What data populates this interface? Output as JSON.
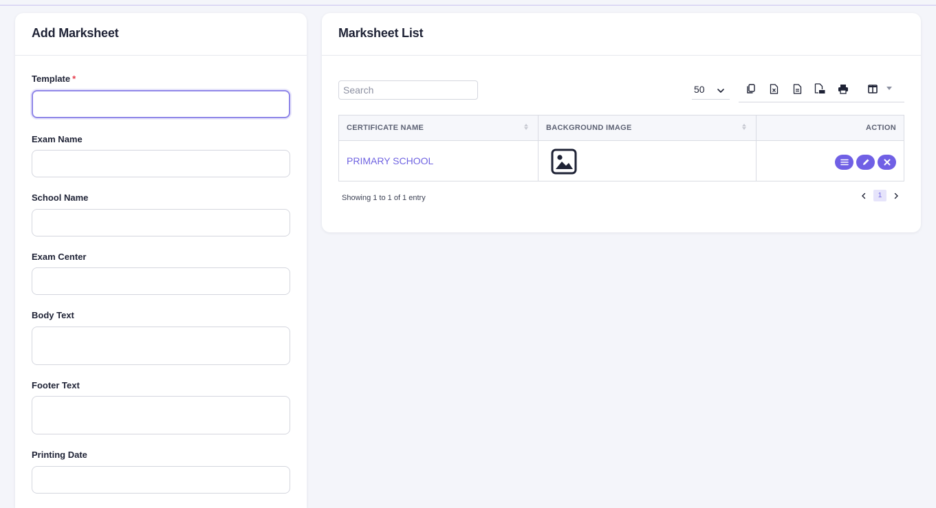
{
  "add_form": {
    "title": "Add Marksheet",
    "fields": [
      {
        "label": "Template",
        "required_mark": "*",
        "value": ""
      },
      {
        "label": "Exam Name",
        "value": ""
      },
      {
        "label": "School Name",
        "value": ""
      },
      {
        "label": "Exam Center",
        "value": ""
      },
      {
        "label": "Body Text",
        "value": ""
      },
      {
        "label": "Footer Text",
        "value": ""
      },
      {
        "label": "Printing Date",
        "value": ""
      }
    ]
  },
  "list": {
    "title": "Marksheet List",
    "search_placeholder": "Search",
    "page_size": "50",
    "toolbar_icons": [
      "copy-icon",
      "excel-icon",
      "csv-icon",
      "pdf-icon",
      "print-icon",
      "columns-icon"
    ],
    "columns": [
      "CERTIFICATE NAME",
      "BACKGROUND IMAGE",
      "ACTION"
    ],
    "rows": [
      {
        "certificate_name": "PRIMARY SCHOOL",
        "background_image": "image-placeholder-icon",
        "actions": [
          "view-icon",
          "edit-icon",
          "delete-icon"
        ]
      }
    ],
    "info": "Showing 1 to 1 of 1 entry",
    "current_page": "1"
  },
  "colors": {
    "accent": "#7060e5",
    "link": "#6f63e1",
    "required": "#e53b4b",
    "page_bg": "#f4f5fa"
  }
}
